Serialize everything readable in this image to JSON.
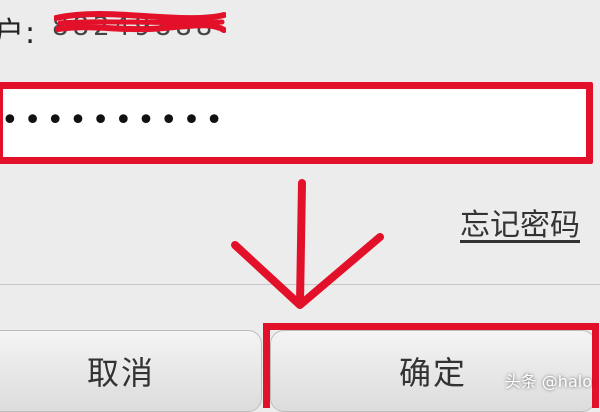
{
  "account": {
    "label": "户:",
    "value": "88249888"
  },
  "password": {
    "value": "••••••••••"
  },
  "forgot_password": "忘记密码",
  "buttons": {
    "cancel": "取消",
    "confirm": "确定"
  },
  "watermark": "头条 @halo",
  "colors": {
    "annotation_red": "#e3102a",
    "background": "#ececec"
  }
}
